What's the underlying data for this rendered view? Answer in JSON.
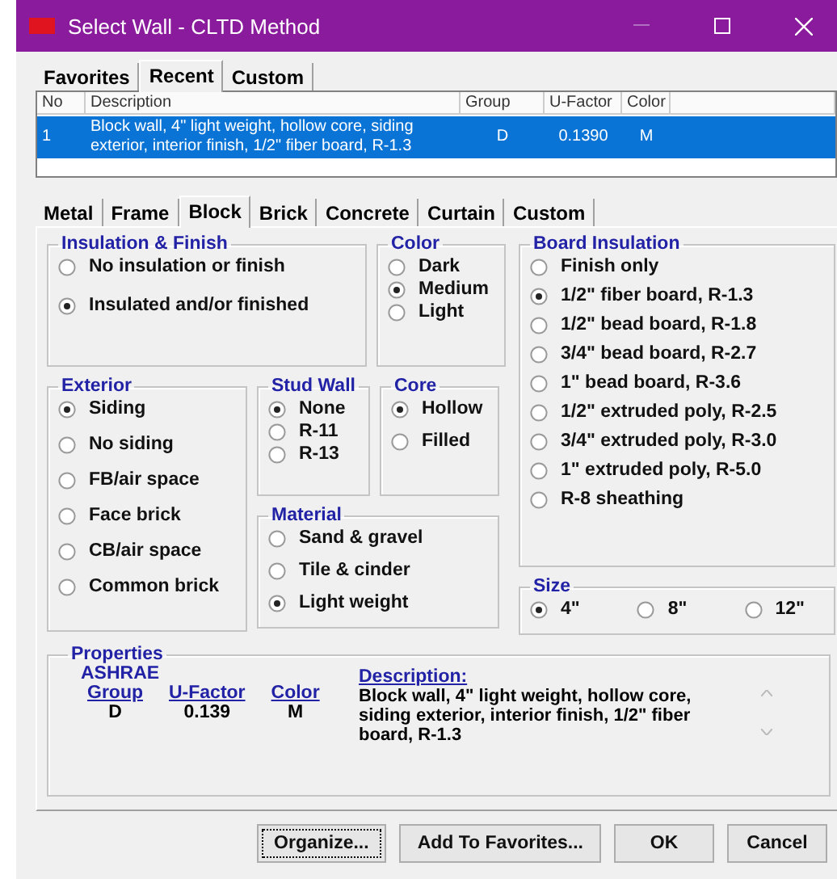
{
  "window": {
    "title": "Select Wall - CLTD Method"
  },
  "list_tabs": [
    {
      "label": "Favorites",
      "selected": false
    },
    {
      "label": "Recent",
      "selected": true
    },
    {
      "label": "Custom",
      "selected": false
    }
  ],
  "list": {
    "columns": [
      "No",
      "Description",
      "Group",
      "U-Factor",
      "Color"
    ],
    "rows": [
      {
        "cells": [
          "1",
          "Block wall, 4\" light weight, hollow core, siding exterior, interior finish, 1/2\" fiber board, R-1.3",
          "D",
          "0.1390",
          "M"
        ],
        "selected": true
      }
    ]
  },
  "type_tabs": [
    {
      "label": "Metal",
      "selected": false
    },
    {
      "label": "Frame",
      "selected": false
    },
    {
      "label": "Block",
      "selected": true
    },
    {
      "label": "Brick",
      "selected": false
    },
    {
      "label": "Concrete",
      "selected": false
    },
    {
      "label": "Curtain",
      "selected": false
    },
    {
      "label": "Custom",
      "selected": false
    }
  ],
  "insulation_finish": {
    "title": "Insulation & Finish",
    "options": [
      {
        "label": "No insulation or finish",
        "selected": false
      },
      {
        "label": "Insulated and/or finished",
        "selected": true
      }
    ]
  },
  "color": {
    "title": "Color",
    "options": [
      {
        "label": "Dark",
        "selected": false
      },
      {
        "label": "Medium",
        "selected": true
      },
      {
        "label": "Light",
        "selected": false
      }
    ]
  },
  "board_insulation": {
    "title": "Board Insulation",
    "options": [
      {
        "label": "Finish only",
        "selected": false
      },
      {
        "label": "1/2\" fiber board, R-1.3",
        "selected": true
      },
      {
        "label": "1/2\" bead board, R-1.8",
        "selected": false
      },
      {
        "label": "3/4\" bead board, R-2.7",
        "selected": false
      },
      {
        "label": "1\" bead board, R-3.6",
        "selected": false
      },
      {
        "label": "1/2\" extruded poly, R-2.5",
        "selected": false
      },
      {
        "label": "3/4\" extruded poly, R-3.0",
        "selected": false
      },
      {
        "label": "1\" extruded poly, R-5.0",
        "selected": false
      },
      {
        "label": "R-8 sheathing",
        "selected": false
      }
    ]
  },
  "exterior": {
    "title": "Exterior",
    "options": [
      {
        "label": "Siding",
        "selected": true
      },
      {
        "label": "No siding",
        "selected": false
      },
      {
        "label": "FB/air space",
        "selected": false
      },
      {
        "label": "Face brick",
        "selected": false
      },
      {
        "label": "CB/air space",
        "selected": false
      },
      {
        "label": "Common brick",
        "selected": false
      }
    ]
  },
  "stud_wall": {
    "title": "Stud Wall",
    "options": [
      {
        "label": "None",
        "selected": true
      },
      {
        "label": "R-11",
        "selected": false
      },
      {
        "label": "R-13",
        "selected": false
      }
    ]
  },
  "core": {
    "title": "Core",
    "options": [
      {
        "label": "Hollow",
        "selected": true
      },
      {
        "label": "Filled",
        "selected": false
      }
    ]
  },
  "material": {
    "title": "Material",
    "options": [
      {
        "label": "Sand & gravel",
        "selected": false
      },
      {
        "label": "Tile & cinder",
        "selected": false
      },
      {
        "label": "Light weight",
        "selected": true
      }
    ]
  },
  "size": {
    "title": "Size",
    "options": [
      {
        "label": "4\"",
        "selected": true
      },
      {
        "label": "8\"",
        "selected": false
      },
      {
        "label": "12\"",
        "selected": false
      }
    ]
  },
  "properties": {
    "title": "Properties",
    "standard": "ASHRAE",
    "fields": [
      {
        "label": "Group",
        "value": "D"
      },
      {
        "label": "U-Factor",
        "value": "0.139"
      },
      {
        "label": "Color",
        "value": "M"
      }
    ],
    "description_label": "Description:",
    "description": "Block wall, 4\" light weight, hollow core, siding exterior, interior finish, 1/2\" fiber board, R-1.3"
  },
  "buttons": [
    {
      "label": "Organize...",
      "focused": true
    },
    {
      "label": "Add To Favorites...",
      "focused": false
    },
    {
      "label": "OK",
      "focused": false
    },
    {
      "label": "Cancel",
      "focused": false
    }
  ]
}
